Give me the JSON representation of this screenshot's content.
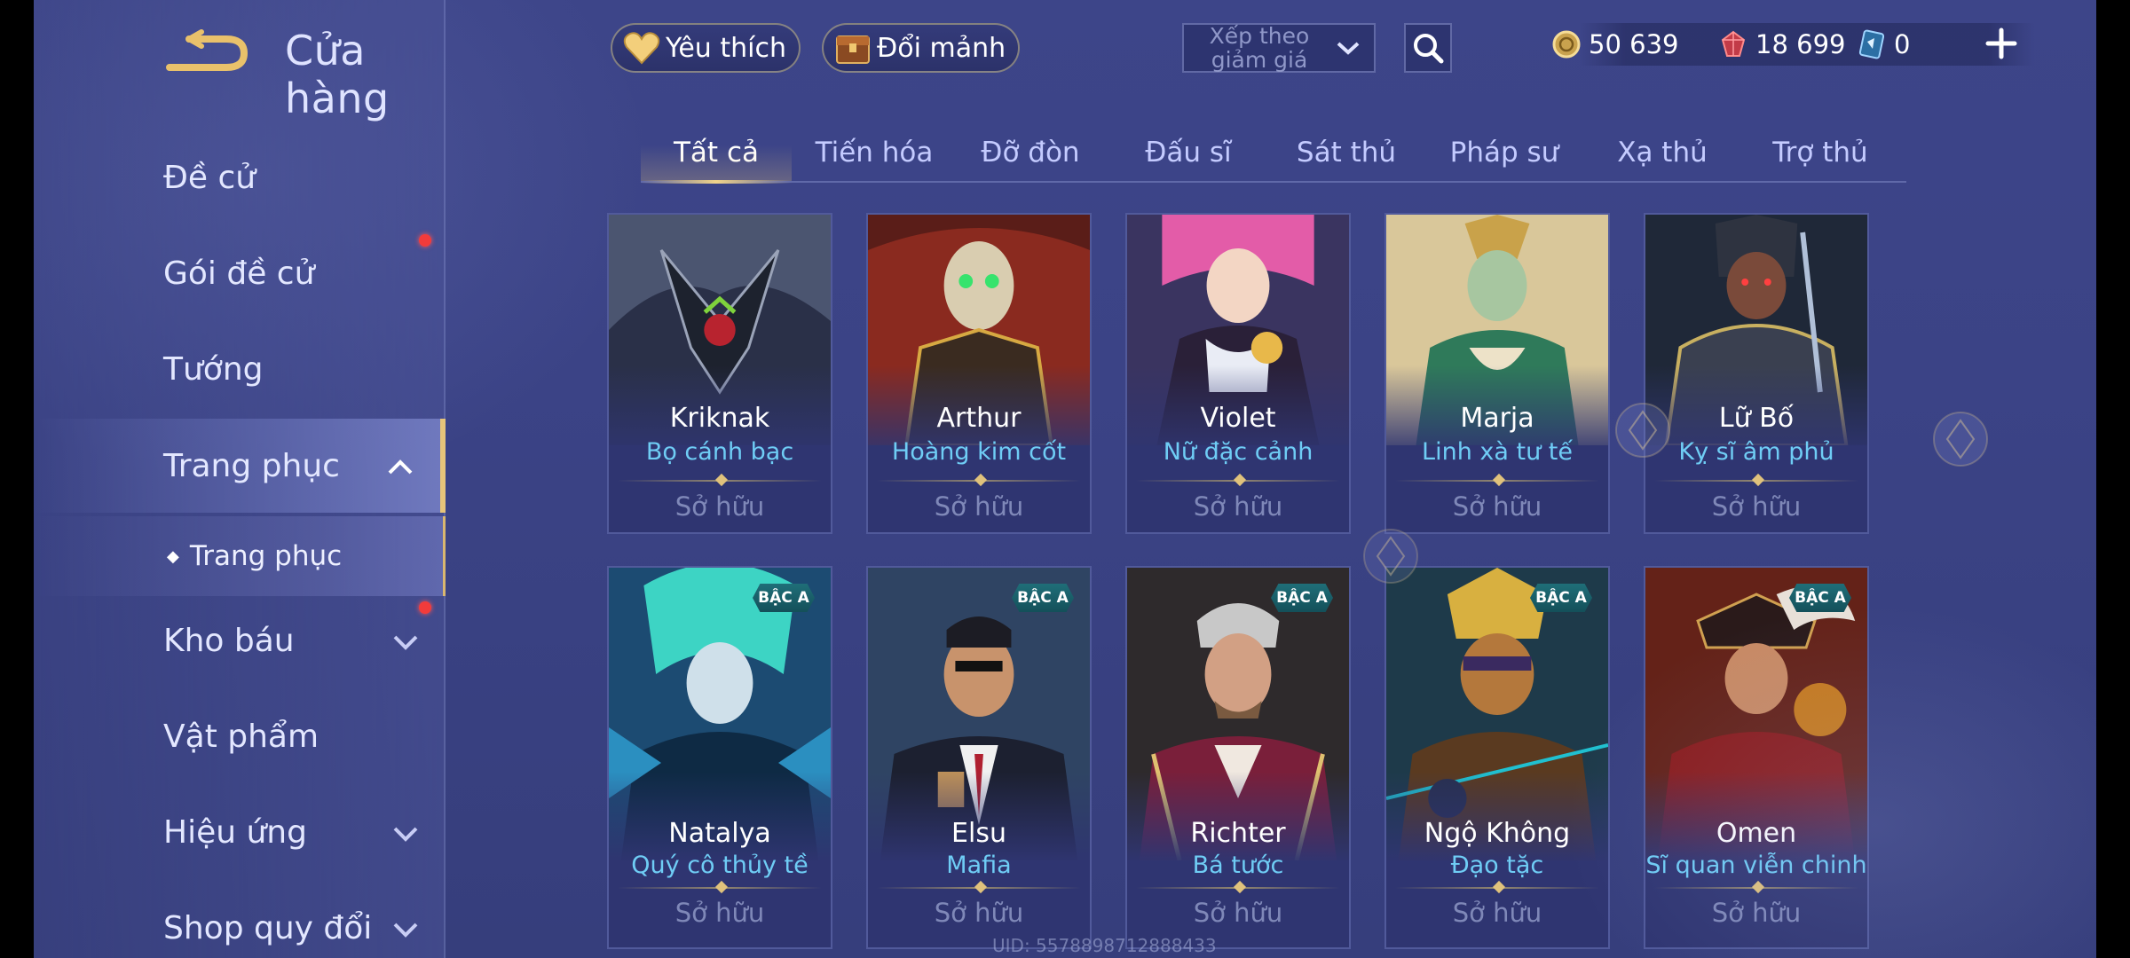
{
  "header": {
    "title": "Cửa hàng"
  },
  "sidebar": {
    "items": [
      {
        "label": "Đề cử"
      },
      {
        "label": "Gói đề cử"
      },
      {
        "label": "Tướng"
      },
      {
        "label": "Trang phục"
      },
      {
        "label": "Kho báu"
      },
      {
        "label": "Vật phẩm"
      },
      {
        "label": "Hiệu ứng"
      },
      {
        "label": "Shop quy đổi"
      }
    ],
    "submenu": {
      "label": "Trang phục"
    }
  },
  "toolbar": {
    "favorites_label": "Yêu thích",
    "exchange_label": "Đổi mảnh",
    "sort_label": "Xếp theo giảm giá"
  },
  "currency": {
    "gold": "50 639",
    "vouchers": "18 699",
    "tickets": "0"
  },
  "tabs": [
    {
      "label": "Tất cả"
    },
    {
      "label": "Tiến hóa"
    },
    {
      "label": "Đỡ đòn"
    },
    {
      "label": "Đấu sĩ"
    },
    {
      "label": "Sát thủ"
    },
    {
      "label": "Pháp sư"
    },
    {
      "label": "Xạ thủ"
    },
    {
      "label": "Trợ thủ"
    }
  ],
  "cards": [
    {
      "hero": "Kriknak",
      "skin": "Bọ cánh bạc",
      "status": "Sở hữu"
    },
    {
      "hero": "Arthur",
      "skin": "Hoàng kim cốt",
      "status": "Sở hữu"
    },
    {
      "hero": "Violet",
      "skin": "Nữ đặc cảnh",
      "status": "Sở hữu"
    },
    {
      "hero": "Marja",
      "skin": "Linh xà tư tế",
      "status": "Sở hữu"
    },
    {
      "hero": "Lữ Bố",
      "skin": "Kỵ sĩ âm phủ",
      "status": "Sở hữu"
    },
    {
      "hero": "Natalya",
      "skin": "Quý cô thủy tề",
      "status": "Sở hữu",
      "badge": "BẬC A"
    },
    {
      "hero": "Elsu",
      "skin": "Mafia",
      "status": "Sở hữu",
      "badge": "BẬC A"
    },
    {
      "hero": "Richter",
      "skin": "Bá tước",
      "status": "Sở hữu",
      "badge": "BẬC A"
    },
    {
      "hero": "Ngộ Không",
      "skin": "Đạo tặc",
      "status": "Sở hữu",
      "badge": "BẬC A"
    },
    {
      "hero": "Omen",
      "skin": "Sĩ quan viễn chinh",
      "status": "Sở hữu",
      "badge": "BẬC A"
    }
  ],
  "footer": {
    "uid": "UID: 5578898712888433"
  },
  "colors": {
    "accent_gold": "#e6c47a",
    "skin_name": "#6fcdf5",
    "badge": "#1f6e78"
  }
}
